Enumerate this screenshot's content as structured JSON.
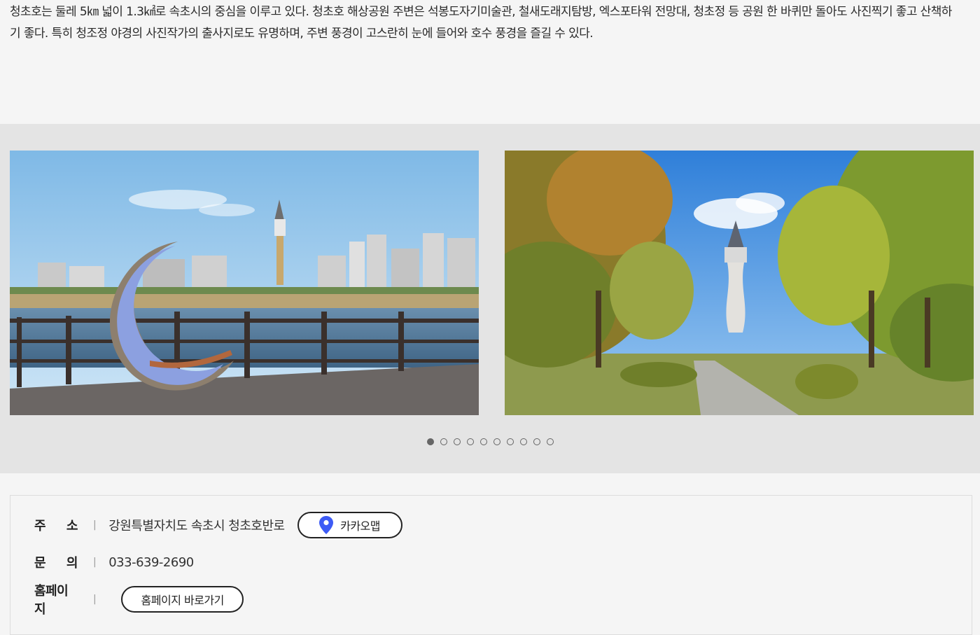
{
  "intro": {
    "text": "청초호는 둘레 5㎞ 넓이 1.3㎢로 속초시의 중심을 이루고 있다. 청초호 해상공원 주변은 석봉도자기미술관, 철새도래지탐방, 엑스포타워 전망대, 청초정 등 공원 한 바퀴만 돌아도 사진찍기 좋고 산책하기 좋다. 특히 청조정 야경의 사진작가의 출사지로도 유명하며, 주변 풍경이 고스란히 눈에 들어와 호수 풍경을 즐길 수 있다."
  },
  "gallery": {
    "slides": [
      {
        "icon": "photo-crescent-moon-bench-lake"
      },
      {
        "icon": "photo-expo-tower-park-path"
      }
    ],
    "dots_total": 10,
    "active_dot": 1
  },
  "info": {
    "address_label": "주    소",
    "address_value": "강원특별자치도 속초시 청초호반로",
    "map_button": "카카오맵",
    "phone_label": "문    의",
    "phone_value": "033-639-2690",
    "homepage_label": "홈페이지",
    "homepage_button": "홈페이지 바로가기",
    "separator": "|",
    "accent_color": "#3d5bf5"
  }
}
